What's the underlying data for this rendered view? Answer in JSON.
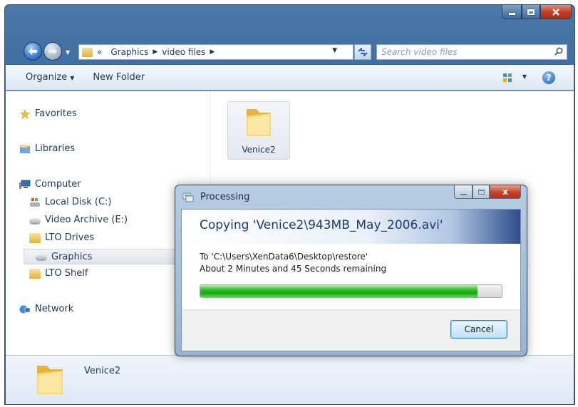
{
  "address_bar": {
    "overflow": "«",
    "crumbs": [
      "Graphics",
      "video files"
    ]
  },
  "search": {
    "placeholder": "Search video files"
  },
  "toolbar": {
    "organize_label": "Organize",
    "new_folder_label": "New Folder",
    "help_glyph": "?"
  },
  "nav_pane": {
    "favorites": "Favorites",
    "libraries": "Libraries",
    "computer": "Computer",
    "local_disk": "Local Disk (C:)",
    "video_archive": "Video Archive (E:)",
    "lto_drives": "LTO Drives",
    "graphics": "Graphics",
    "lto_shelf": "LTO Shelf",
    "network": "Network"
  },
  "content": {
    "folder_name": "Venice2"
  },
  "details": {
    "name": "Venice2"
  },
  "dialog": {
    "title": "Processing",
    "heading": "Copying 'Venice2\\943MB_May_2006.avi'",
    "destination": "To 'C:\\Users\\XenData6\\Desktop\\restore'",
    "remaining": "About 2 Minutes and 45 Seconds remaining",
    "progress_fraction": 0.92,
    "cancel_label": "Cancel",
    "close_glyph": "x"
  },
  "icons": {
    "back": "back-arrow-icon",
    "forward": "forward-arrow-icon",
    "refresh": "refresh-icon",
    "search": "search-icon",
    "help": "help-icon",
    "folder": "folder-icon"
  },
  "colors": {
    "progress_green": "#17a80e",
    "title_blue": "#1b3a6e",
    "window_frame": "#2f5f95"
  }
}
